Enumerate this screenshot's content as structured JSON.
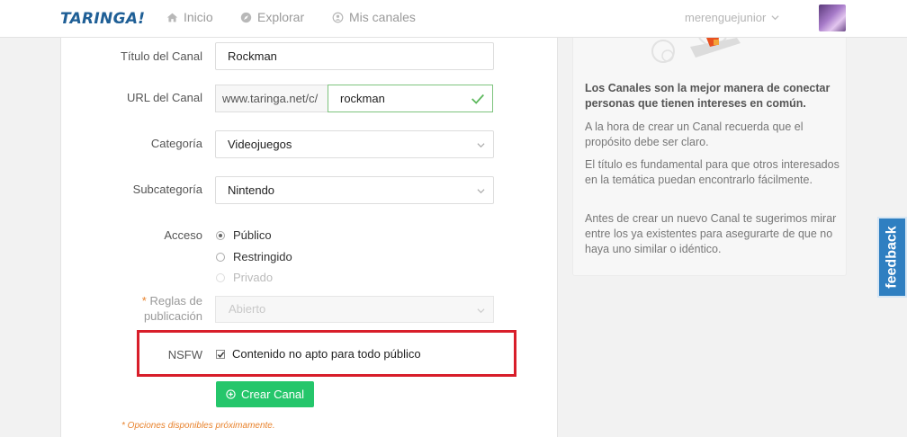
{
  "header": {
    "logo": "TARINGA!",
    "nav": [
      {
        "label": "Inicio",
        "icon": "home-icon"
      },
      {
        "label": "Explorar",
        "icon": "compass-icon"
      },
      {
        "label": "Mis canales",
        "icon": "channels-icon"
      }
    ],
    "username": "merenguejunior"
  },
  "form": {
    "title_label": "Título del Canal",
    "title_value": "Rockman",
    "url_label": "URL del Canal",
    "url_prefix": "www.taringa.net/c/",
    "url_value": "rockman",
    "category_label": "Categoría",
    "category_value": "Videojuegos",
    "subcategory_label": "Subcategoría",
    "subcategory_value": "Nintendo",
    "access_label": "Acceso",
    "access_options": [
      "Público",
      "Restringido",
      "Privado"
    ],
    "access_selected": "Público",
    "rules_label_1": "Reglas de",
    "rules_label_2": "publicación",
    "rules_value": "Abierto",
    "asterisk": "*",
    "nsfw_label": "NSFW",
    "nsfw_checkbox_label": "Contenido no apto para todo público",
    "nsfw_checked": true,
    "submit_label": "Crear Canal",
    "footnote": "* Opciones disponibles próximamente."
  },
  "info": {
    "headline": "Los Canales son la mejor manera de conectar personas que tienen intereses en común.",
    "p1": "A la hora de crear un Canal recuerda que el propósito debe ser claro.",
    "p2": "El título es fundamental para que otros interesados en la temática puedan encontrarlo fácilmente.",
    "p3": "Antes de crear un nuevo Canal te sugerimos mirar entre los ya existentes para asegurarte de que no haya uno similar o idéntico."
  },
  "feedback_label": "feedback",
  "colors": {
    "brand": "#1f5f96",
    "accent_green": "#25c66b",
    "highlight_red": "#d81e2a",
    "asterisk_orange": "#e8822c",
    "feedback_blue": "#2f7fc1"
  }
}
